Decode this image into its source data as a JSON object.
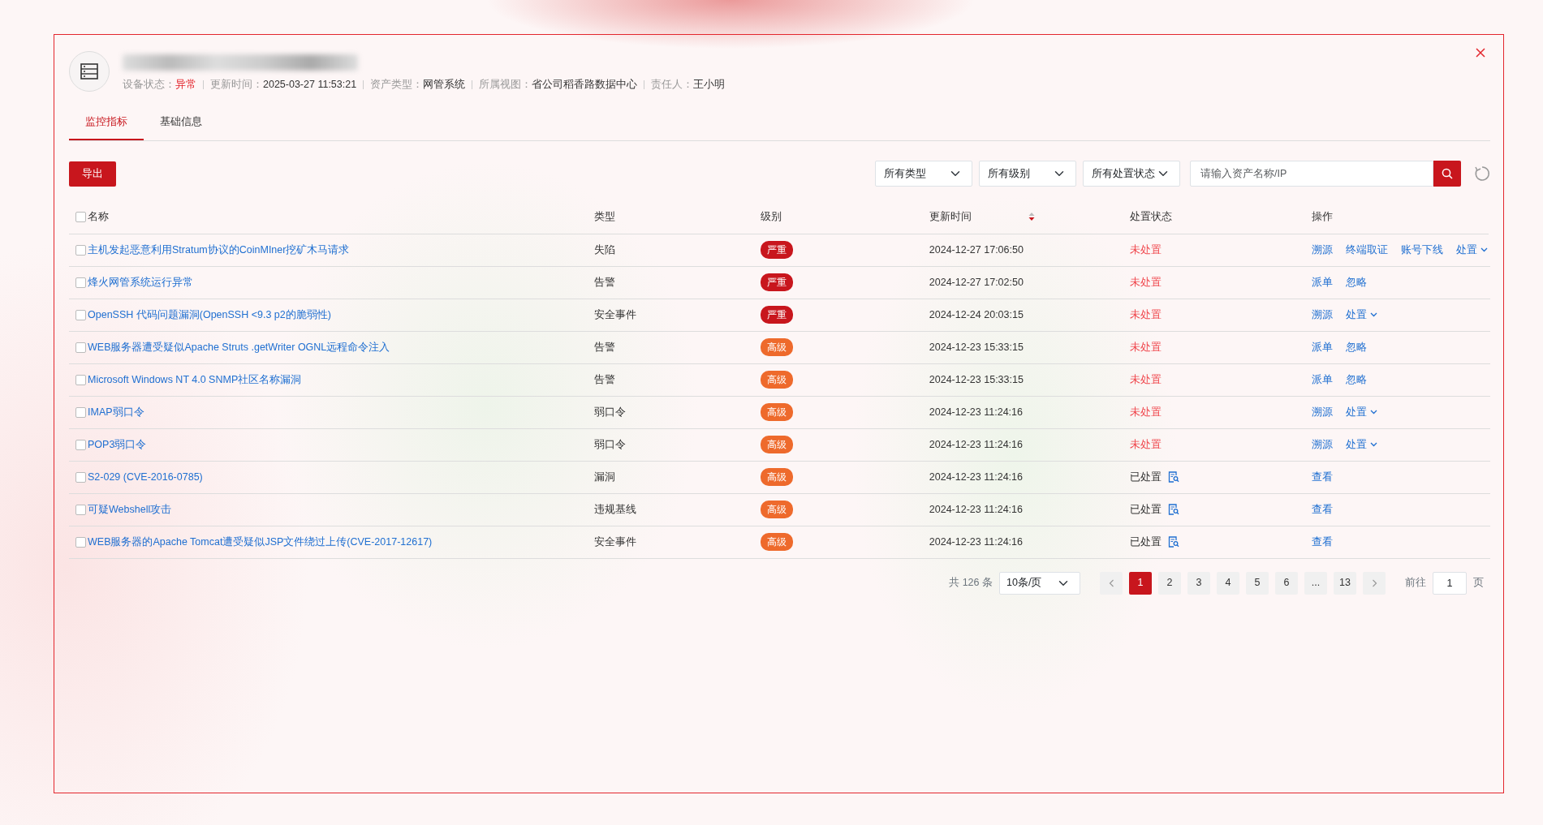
{
  "device": {
    "meta": [
      {
        "label": "设备状态：",
        "value": "异常",
        "alert": true
      },
      {
        "label": "更新时间：",
        "value": "2025-03-27 11:53:21",
        "alert": false
      },
      {
        "label": "资产类型：",
        "value": "网管系统",
        "alert": false
      },
      {
        "label": "所属视图：",
        "value": "省公司稻香路数据中心",
        "alert": false
      },
      {
        "label": "责任人：",
        "value": "王小明",
        "alert": false
      }
    ]
  },
  "tabs": [
    {
      "label": "监控指标",
      "selected": true
    },
    {
      "label": "基础信息",
      "selected": false
    }
  ],
  "toolbar": {
    "export": "导出",
    "filters": [
      "所有类型",
      "所有级别",
      "所有处置状态"
    ],
    "search": {
      "placeholder": "请输入资产名称/IP"
    }
  },
  "table": {
    "columns": [
      "名称",
      "类型",
      "级别",
      "更新时间",
      "处置状态",
      "操作"
    ],
    "header_checked": false,
    "sorted_descending": true,
    "rows": [
      {
        "checked": false,
        "name": "主机发起恶意利用Stratum协议的CoinMIner挖矿木马请求",
        "type": "失陷",
        "level": "严重",
        "color": "#c8161d",
        "time": "2024-12-27 17:06:50",
        "status": "未处置",
        "handled": false,
        "actions": [
          {
            "label": "溯源",
            "dropdown": false
          },
          {
            "label": "终端取证",
            "dropdown": false
          },
          {
            "label": "账号下线",
            "dropdown": false
          },
          {
            "label": "处置",
            "dropdown": true
          }
        ]
      },
      {
        "checked": false,
        "name": "烽火网管系统运行异常",
        "type": "告警",
        "level": "严重",
        "color": "#c8161d",
        "time": "2024-12-27 17:02:50",
        "status": "未处置",
        "handled": false,
        "actions": [
          {
            "label": "派单",
            "dropdown": false
          },
          {
            "label": "忽略",
            "dropdown": false
          }
        ]
      },
      {
        "checked": false,
        "name": "OpenSSH 代码问题漏洞(OpenSSH <9.3 p2的脆弱性)",
        "type": "安全事件",
        "level": "严重",
        "color": "#c8161d",
        "time": "2024-12-24 20:03:15",
        "status": "未处置",
        "handled": false,
        "actions": [
          {
            "label": "溯源",
            "dropdown": false
          },
          {
            "label": "处置",
            "dropdown": true
          }
        ]
      },
      {
        "checked": false,
        "name": "WEB服务器遭受疑似Apache Struts .getWriter OGNL远程命令注入",
        "type": "告警",
        "level": "高级",
        "color": "#ee6a2c",
        "time": "2024-12-23 15:33:15",
        "status": "未处置",
        "handled": false,
        "actions": [
          {
            "label": "派单",
            "dropdown": false
          },
          {
            "label": "忽略",
            "dropdown": false
          }
        ]
      },
      {
        "checked": false,
        "name": "Microsoft Windows NT 4.0 SNMP社区名称漏洞",
        "type": "告警",
        "level": "高级",
        "color": "#ee6a2c",
        "time": "2024-12-23 15:33:15",
        "status": "未处置",
        "handled": false,
        "actions": [
          {
            "label": "派单",
            "dropdown": false
          },
          {
            "label": "忽略",
            "dropdown": false
          }
        ]
      },
      {
        "checked": false,
        "name": "IMAP弱口令",
        "type": "弱口令",
        "level": "高级",
        "color": "#ee6a2c",
        "time": "2024-12-23 11:24:16",
        "status": "未处置",
        "handled": false,
        "actions": [
          {
            "label": "溯源",
            "dropdown": false
          },
          {
            "label": "处置",
            "dropdown": true
          }
        ]
      },
      {
        "checked": false,
        "name": "POP3弱口令",
        "type": "弱口令",
        "level": "高级",
        "color": "#ee6a2c",
        "time": "2024-12-23 11:24:16",
        "status": "未处置",
        "handled": false,
        "actions": [
          {
            "label": "溯源",
            "dropdown": false
          },
          {
            "label": "处置",
            "dropdown": true
          }
        ]
      },
      {
        "checked": false,
        "name": "S2-029 (CVE-2016-0785)",
        "type": "漏洞",
        "level": "高级",
        "color": "#ee6a2c",
        "time": "2024-12-23 11:24:16",
        "status": "已处置",
        "handled": true,
        "actions": [
          {
            "label": "查看",
            "dropdown": false
          }
        ]
      },
      {
        "checked": false,
        "name": "可疑Webshell攻击",
        "type": "违规基线",
        "level": "高级",
        "color": "#ee6a2c",
        "time": "2024-12-23 11:24:16",
        "status": "已处置",
        "handled": true,
        "actions": [
          {
            "label": "查看",
            "dropdown": false
          }
        ]
      },
      {
        "checked": false,
        "name": "WEB服务器的Apache Tomcat遭受疑似JSP文件绕过上传(CVE-2017-12617)",
        "type": "安全事件",
        "level": "高级",
        "color": "#ee6a2c",
        "time": "2024-12-23 11:24:16",
        "status": "已处置",
        "handled": true,
        "actions": [
          {
            "label": "查看",
            "dropdown": false
          }
        ]
      }
    ]
  },
  "pagination": {
    "total": "共 126 条",
    "page_size": "10条/页",
    "pages": [
      {
        "label": "1",
        "selected": true
      },
      {
        "label": "2",
        "selected": false
      },
      {
        "label": "3",
        "selected": false
      },
      {
        "label": "4",
        "selected": false
      },
      {
        "label": "5",
        "selected": false
      },
      {
        "label": "6",
        "selected": false
      },
      {
        "label": "...",
        "selected": false
      },
      {
        "label": "13",
        "selected": false
      }
    ],
    "goto_label": "前往",
    "goto_value": "1",
    "page_unit": "页"
  }
}
